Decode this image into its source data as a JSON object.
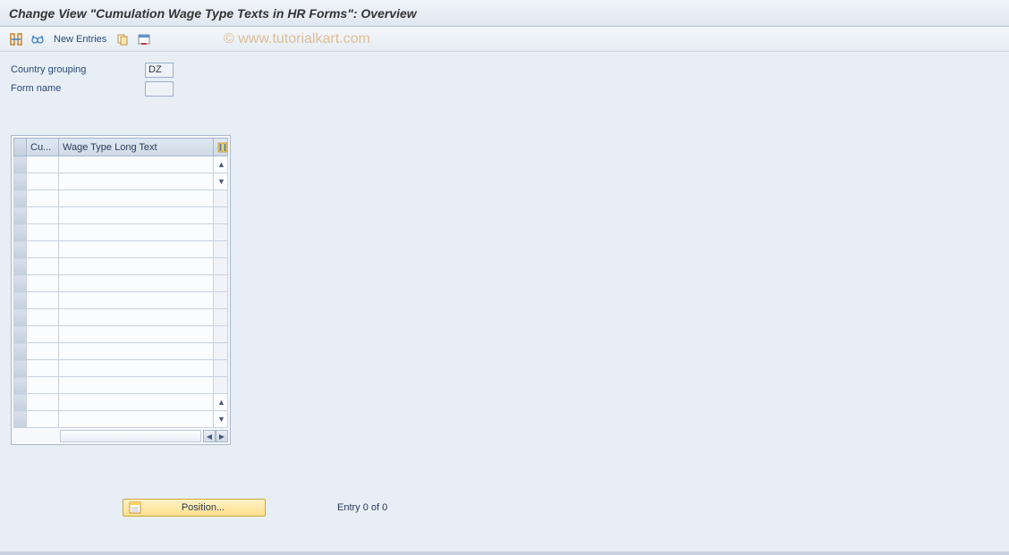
{
  "title": "Change View \"Cumulation Wage Type Texts in HR Forms\": Overview",
  "toolbar": {
    "new_entries_label": "New Entries"
  },
  "watermark": "© www.tutorialkart.com",
  "fields": {
    "country_grouping_label": "Country grouping",
    "country_grouping_value": "DZ",
    "form_name_label": "Form name",
    "form_name_value": ""
  },
  "table": {
    "columns": {
      "cu": "Cu...",
      "wage_text": "Wage Type Long Text"
    },
    "rows": 16
  },
  "footer": {
    "position_label": "Position...",
    "entry_text": "Entry 0 of 0"
  }
}
